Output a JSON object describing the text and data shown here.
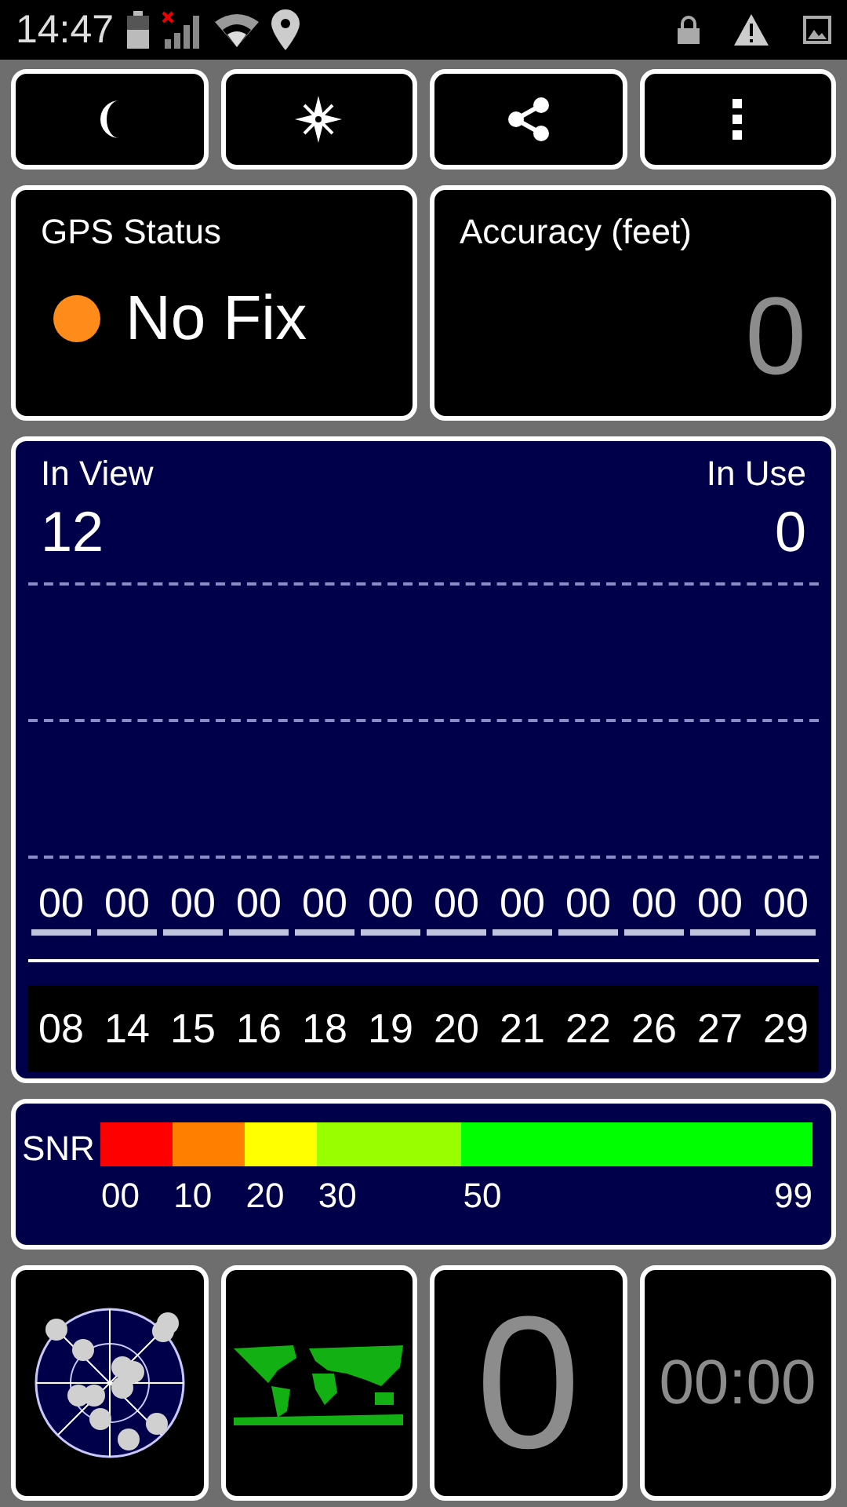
{
  "status_bar": {
    "time": "14:47"
  },
  "toolbar": [
    {
      "kind": "night"
    },
    {
      "kind": "compass"
    },
    {
      "kind": "share"
    },
    {
      "kind": "menu"
    }
  ],
  "gps_status": {
    "title": "GPS Status",
    "status": "No Fix",
    "color": "#ff8c1a"
  },
  "accuracy": {
    "title": "Accuracy (feet)",
    "value": "0"
  },
  "satellites": {
    "in_view_label": "In View",
    "in_view": "12",
    "in_use_label": "In Use",
    "in_use": "0",
    "items": [
      {
        "snr": "00",
        "prn": "08"
      },
      {
        "snr": "00",
        "prn": "14"
      },
      {
        "snr": "00",
        "prn": "15"
      },
      {
        "snr": "00",
        "prn": "16"
      },
      {
        "snr": "00",
        "prn": "18"
      },
      {
        "snr": "00",
        "prn": "19"
      },
      {
        "snr": "00",
        "prn": "20"
      },
      {
        "snr": "00",
        "prn": "21"
      },
      {
        "snr": "00",
        "prn": "22"
      },
      {
        "snr": "00",
        "prn": "26"
      },
      {
        "snr": "00",
        "prn": "27"
      },
      {
        "snr": "00",
        "prn": "29"
      }
    ]
  },
  "snr_legend": {
    "label": "SNR",
    "segments": [
      {
        "label": "00",
        "color": "#ff0000"
      },
      {
        "label": "10",
        "color": "#ff8000"
      },
      {
        "label": "20",
        "color": "#ffff00"
      },
      {
        "label": "30",
        "color": "#99ff00"
      },
      {
        "label": "50",
        "color": "#00ff00"
      }
    ],
    "end_label": "99"
  },
  "tiles": [
    {
      "kind": "sky_plot"
    },
    {
      "kind": "world_map"
    },
    {
      "kind": "count",
      "value": "0"
    },
    {
      "kind": "timer",
      "value": "00:00"
    }
  ]
}
